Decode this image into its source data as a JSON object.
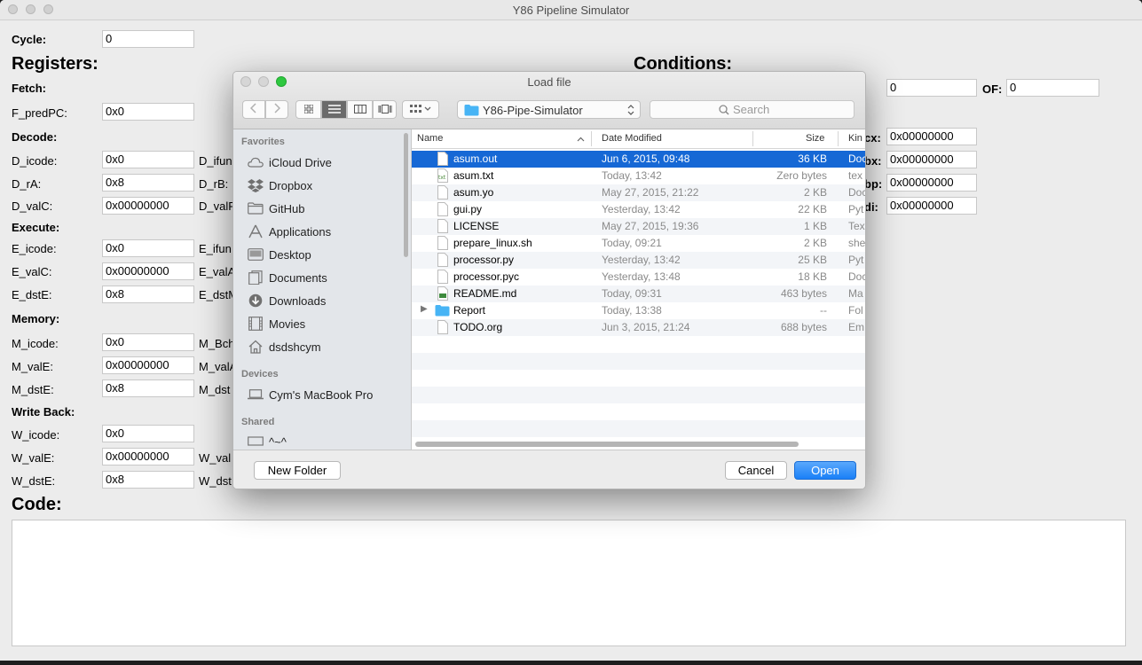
{
  "window": {
    "title": "Y86 Pipeline Simulator"
  },
  "cycle": {
    "label": "Cycle:",
    "value": "0"
  },
  "registers": {
    "heading": "Registers:",
    "fetch": {
      "title": "Fetch:",
      "f_predpc_label": "F_predPC:",
      "f_predpc_value": "0x0"
    },
    "decode": {
      "title": "Decode:",
      "d_icode_label": "D_icode:",
      "d_icode_value": "0x0",
      "d_ifun_label": "D_ifun",
      "d_ra_label": "D_rA:",
      "d_ra_value": "0x8",
      "d_rb_label": "D_rB:",
      "d_valc_label": "D_valC:",
      "d_valc_value": "0x00000000",
      "d_valp_label": "D_valP"
    },
    "execute": {
      "title": "Execute:",
      "e_icode_label": "E_icode:",
      "e_icode_value": "0x0",
      "e_ifun_label": "E_ifun",
      "e_valc_label": "E_valC:",
      "e_valc_value": "0x00000000",
      "e_vala_label": "E_valA",
      "e_dste_label": "E_dstE:",
      "e_dste_value": "0x8",
      "e_dstm_label": "E_dstM"
    },
    "memory": {
      "title": "Memory:",
      "m_icode_label": "M_icode:",
      "m_icode_value": "0x0",
      "m_bch_label": "M_Bch",
      "m_vale_label": "M_valE:",
      "m_vale_value": "0x00000000",
      "m_vala_label": "M_valA",
      "m_dste_label": "M_dstE:",
      "m_dste_value": "0x8",
      "m_dstm_label": "M_dst"
    },
    "writeback": {
      "title": "Write Back:",
      "w_icode_label": "W_icode:",
      "w_icode_value": "0x0",
      "w_vale_label": "W_valE:",
      "w_vale_value": "0x00000000",
      "w_valm_label": "W_val",
      "w_dste_label": "W_dstE:",
      "w_dste_value": "0x8",
      "w_dstm_label": "W_dst"
    }
  },
  "conditions": {
    "heading": "Conditions:",
    "cond1_value": "0",
    "of_label": "OF:",
    "of_value": "0",
    "reg_ecx_label": "cx:",
    "reg_ecx_value": "0x00000000",
    "reg_ebx_label": "bx:",
    "reg_ebx_value": "0x00000000",
    "reg_ebp_label": "bp:",
    "reg_ebp_value": "0x00000000",
    "reg_edi_label": "di:",
    "reg_edi_value": "0x00000000"
  },
  "code": {
    "heading": "Code:"
  },
  "dialog": {
    "title": "Load file",
    "path": "Y86-Pipe-Simulator",
    "search_placeholder": "Search",
    "sidebar": {
      "favorites_title": "Favorites",
      "favorites": [
        {
          "label": "iCloud Drive",
          "icon": "cloud-icon"
        },
        {
          "label": "Dropbox",
          "icon": "dropbox-icon"
        },
        {
          "label": "GitHub",
          "icon": "folder-icon"
        },
        {
          "label": "Applications",
          "icon": "applications-icon"
        },
        {
          "label": "Desktop",
          "icon": "desktop-icon"
        },
        {
          "label": "Documents",
          "icon": "documents-icon"
        },
        {
          "label": "Downloads",
          "icon": "downloads-icon"
        },
        {
          "label": "Movies",
          "icon": "movies-icon"
        },
        {
          "label": "dsdshcym",
          "icon": "home-icon"
        }
      ],
      "devices_title": "Devices",
      "devices": [
        {
          "label": "Cym's MacBook Pro",
          "icon": "laptop-icon"
        }
      ],
      "shared_title": "Shared",
      "shared": [
        {
          "label": "^~^",
          "icon": "monitor-icon"
        }
      ]
    },
    "columns": {
      "name": "Name",
      "date": "Date Modified",
      "size": "Size",
      "kind": "Kin"
    },
    "files": [
      {
        "name": "asum.out",
        "date": "Jun 6, 2015, 09:48",
        "size": "36 KB",
        "kind": "Doc",
        "selected": true
      },
      {
        "name": "asum.txt",
        "date": "Today, 13:42",
        "size": "Zero bytes",
        "kind": "tex"
      },
      {
        "name": "asum.yo",
        "date": "May 27, 2015, 21:22",
        "size": "2 KB",
        "kind": "Doc"
      },
      {
        "name": "gui.py",
        "date": "Yesterday, 13:42",
        "size": "22 KB",
        "kind": "Pyt"
      },
      {
        "name": "LICENSE",
        "date": "May 27, 2015, 19:36",
        "size": "1 KB",
        "kind": "Tex"
      },
      {
        "name": "prepare_linux.sh",
        "date": "Today, 09:21",
        "size": "2 KB",
        "kind": "she"
      },
      {
        "name": "processor.py",
        "date": "Yesterday, 13:42",
        "size": "25 KB",
        "kind": "Pyt"
      },
      {
        "name": "processor.pyc",
        "date": "Yesterday, 13:48",
        "size": "18 KB",
        "kind": "Doc"
      },
      {
        "name": "README.md",
        "date": "Today, 09:31",
        "size": "463 bytes",
        "kind": "Ma"
      },
      {
        "name": "Report",
        "date": "Today, 13:38",
        "size": "--",
        "kind": "Fol",
        "folder": true
      },
      {
        "name": "TODO.org",
        "date": "Jun 3, 2015, 21:24",
        "size": "688 bytes",
        "kind": "Em"
      }
    ],
    "buttons": {
      "new_folder": "New Folder",
      "cancel": "Cancel",
      "open": "Open"
    }
  },
  "colors": {
    "selection": "#1668d5",
    "open_button": "#1a80f7",
    "folder_blue": "#47b4f5"
  }
}
